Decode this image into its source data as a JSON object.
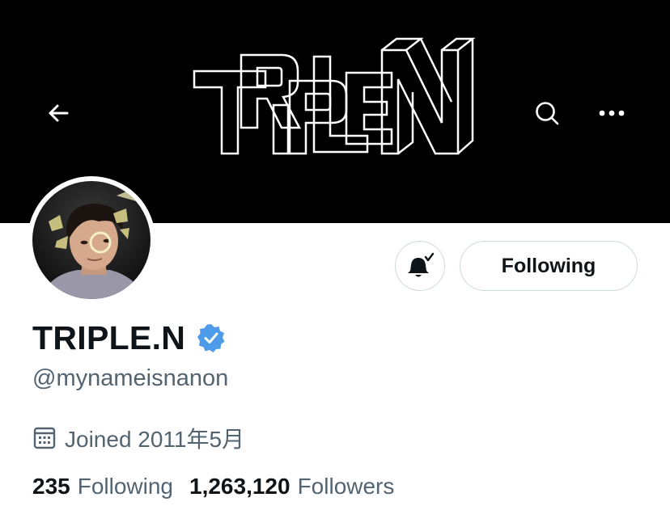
{
  "banner": {
    "background": "#000000",
    "art_text": "TRIPLE N"
  },
  "topbar": {
    "back_icon": "arrow-left-icon",
    "search_icon": "search-icon",
    "more_icon": "more-horizontal-icon"
  },
  "profile": {
    "display_name": "TRIPLE.N",
    "verified": true,
    "verified_color": "#4d9be9",
    "handle": "@mynameisnanon",
    "joined": "Joined 2011年5月",
    "joined_icon": "calendar-icon"
  },
  "actions": {
    "notify_icon": "bell-check-icon",
    "following_label": "Following"
  },
  "stats": {
    "following_count": "235",
    "following_label": "Following",
    "followers_count": "1,263,120",
    "followers_label": "Followers"
  }
}
